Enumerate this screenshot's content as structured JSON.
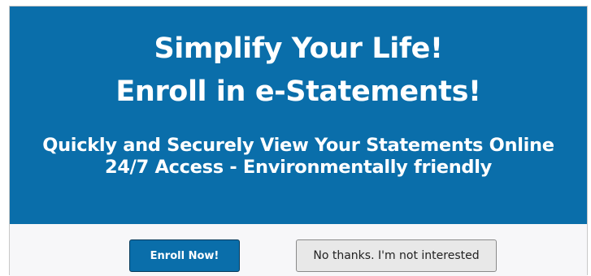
{
  "banner": {
    "title_lines": [
      "Simplify Your Life!",
      "Enroll in e-Statements!"
    ],
    "subtitle_lines": [
      "Quickly and Securely View Your Statements Online",
      "24/7 Access - Environmentally friendly"
    ]
  },
  "actions": {
    "enroll_label": "Enroll Now!",
    "decline_label": "No thanks. I'm not interested"
  },
  "colors": {
    "banner_blue": "#0a6eaa",
    "footer_bg": "#f7f7f9",
    "secondary_button_bg": "#e8e8e8"
  }
}
